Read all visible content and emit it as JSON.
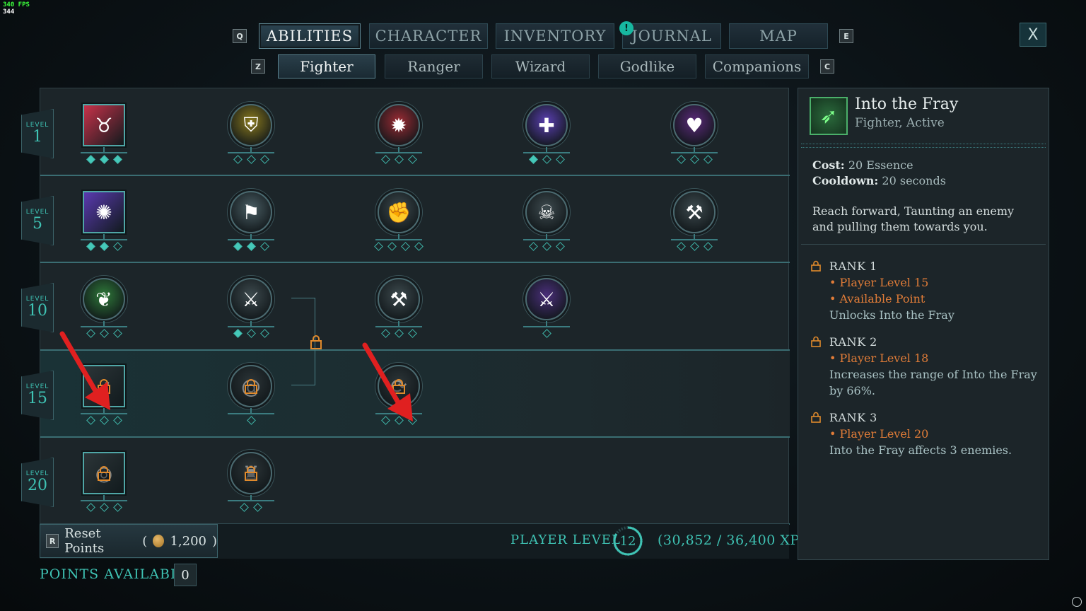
{
  "fps": {
    "line1": "340 FPS",
    "line2": "344"
  },
  "top_tabs": {
    "left_key": "Q",
    "right_key": "E",
    "items": [
      {
        "label": "ABILITIES",
        "active": true
      },
      {
        "label": "CHARACTER",
        "active": false
      },
      {
        "label": "INVENTORY",
        "active": false
      },
      {
        "label": "JOURNAL",
        "active": false
      },
      {
        "label": "MAP",
        "active": false
      }
    ],
    "journal_notification": "!"
  },
  "close_label": "X",
  "class_tabs": {
    "left_key": "Z",
    "right_key": "C",
    "items": [
      {
        "label": "Fighter",
        "active": true
      },
      {
        "label": "Ranger",
        "active": false
      },
      {
        "label": "Wizard",
        "active": false
      },
      {
        "label": "Godlike",
        "active": false
      },
      {
        "label": "Companions",
        "active": false
      }
    ]
  },
  "levels": [
    {
      "caption": "LEVEL",
      "value": "1"
    },
    {
      "caption": "LEVEL",
      "value": "5"
    },
    {
      "caption": "LEVEL",
      "value": "10"
    },
    {
      "caption": "LEVEL",
      "value": "15"
    },
    {
      "caption": "LEVEL",
      "value": "20"
    }
  ],
  "abilities": [
    {
      "row": 0,
      "col": 0,
      "shape": "square",
      "icon": "bull-icon",
      "color": "#c8324a",
      "ranks": 3,
      "filled": 3,
      "locked": false
    },
    {
      "row": 0,
      "col": 1,
      "shape": "round",
      "icon": "shield-icon",
      "color": "#8a7a1e",
      "ranks": 3,
      "filled": 0,
      "locked": false
    },
    {
      "row": 0,
      "col": 2,
      "shape": "round",
      "icon": "burst-shield-icon",
      "color": "#9b2b34",
      "ranks": 3,
      "filled": 0,
      "locked": false
    },
    {
      "row": 0,
      "col": 3,
      "shape": "round",
      "icon": "crosses-icon",
      "color": "#5a3fb0",
      "ranks": 3,
      "filled": 1,
      "locked": false
    },
    {
      "row": 0,
      "col": 4,
      "shape": "round",
      "icon": "heart-icon",
      "color": "#5b2a7a",
      "ranks": 3,
      "filled": 0,
      "locked": false
    },
    {
      "row": 1,
      "col": 0,
      "shape": "square",
      "icon": "beast-icon",
      "color": "#5a3ab0",
      "ranks": 3,
      "filled": 2,
      "locked": false
    },
    {
      "row": 1,
      "col": 1,
      "shape": "round",
      "icon": "banner-icon",
      "color": "#4a5e64",
      "ranks": 3,
      "filled": 2,
      "locked": false
    },
    {
      "row": 1,
      "col": 2,
      "shape": "round",
      "icon": "fist-icon",
      "color": "#3d4a4e",
      "ranks": 4,
      "filled": 0,
      "locked": false
    },
    {
      "row": 1,
      "col": 3,
      "shape": "round",
      "icon": "skull-sword-icon",
      "color": "#3d4a4e",
      "ranks": 3,
      "filled": 0,
      "locked": false
    },
    {
      "row": 1,
      "col": 4,
      "shape": "round",
      "icon": "axe-icon",
      "color": "#3d4a4e",
      "ranks": 3,
      "filled": 0,
      "locked": false
    },
    {
      "row": 2,
      "col": 0,
      "shape": "round",
      "icon": "grass-icon",
      "color": "#2f7a3a",
      "ranks": 3,
      "filled": 0,
      "locked": false
    },
    {
      "row": 2,
      "col": 1,
      "shape": "round",
      "icon": "sword-shield-icon",
      "color": "#3d4a4e",
      "ranks": 3,
      "filled": 1,
      "locked": false
    },
    {
      "row": 2,
      "col": 2,
      "shape": "round",
      "icon": "hammer-icon",
      "color": "#3d4a4e",
      "ranks": 3,
      "filled": 0,
      "locked": false
    },
    {
      "row": 2,
      "col": 3,
      "shape": "round",
      "icon": "crossed-swords-icon",
      "color": "#4a2f7a",
      "ranks": 1,
      "filled": 0,
      "locked": false
    },
    {
      "row": 3,
      "col": 0,
      "shape": "square",
      "icon": "into-the-fray-icon",
      "color": "#3a5e4c",
      "ranks": 3,
      "filled": 0,
      "locked": true
    },
    {
      "row": 3,
      "col": 1,
      "shape": "round",
      "icon": "spiral-icon",
      "color": "#3d4a4e",
      "ranks": 1,
      "filled": 0,
      "locked": true
    },
    {
      "row": 3,
      "col": 2,
      "shape": "round",
      "icon": "whirl-icon",
      "color": "#3d4a4e",
      "ranks": 3,
      "filled": 0,
      "locked": true
    },
    {
      "row": 4,
      "col": 0,
      "shape": "square",
      "icon": "vortex-icon",
      "color": "#3d4a4e",
      "ranks": 3,
      "filled": 0,
      "locked": true
    },
    {
      "row": 4,
      "col": 1,
      "shape": "round",
      "icon": "fighter-icon",
      "color": "#3d4a4e",
      "ranks": 2,
      "filled": 0,
      "locked": true
    }
  ],
  "bottom": {
    "reset_key": "R",
    "reset_label": "Reset Points",
    "reset_cost": "1,200",
    "player_level_label": "PLAYER LEVEL",
    "player_level": "12",
    "xp": "(30,852 / 36,400 XP)",
    "points_available_label": "POINTS AVAILABLE",
    "points_available": "0"
  },
  "detail": {
    "icon": "into-the-fray-icon",
    "title": "Into the Fray",
    "subtitle": "Fighter, Active",
    "cost_label": "Cost:",
    "cost_value": "20 Essence",
    "cooldown_label": "Cooldown:",
    "cooldown_value": "20 seconds",
    "description": "Reach forward, Taunting an enemy and pulling them towards you.",
    "ranks": [
      {
        "title": "RANK 1",
        "requirements": [
          "• Player Level 15",
          "• Available Point"
        ],
        "effect": "Unlocks Into the Fray"
      },
      {
        "title": "RANK 2",
        "requirements": [
          "• Player Level 18"
        ],
        "effect": "Increases the range of Into the Fray by 66%."
      },
      {
        "title": "RANK 3",
        "requirements": [
          "• Player Level 20"
        ],
        "effect": "Into the Fray affects 3 enemies."
      }
    ]
  },
  "colors": {
    "accent": "#3fc3b4",
    "requirement": "#e07c38",
    "arrow": "#e02020"
  }
}
